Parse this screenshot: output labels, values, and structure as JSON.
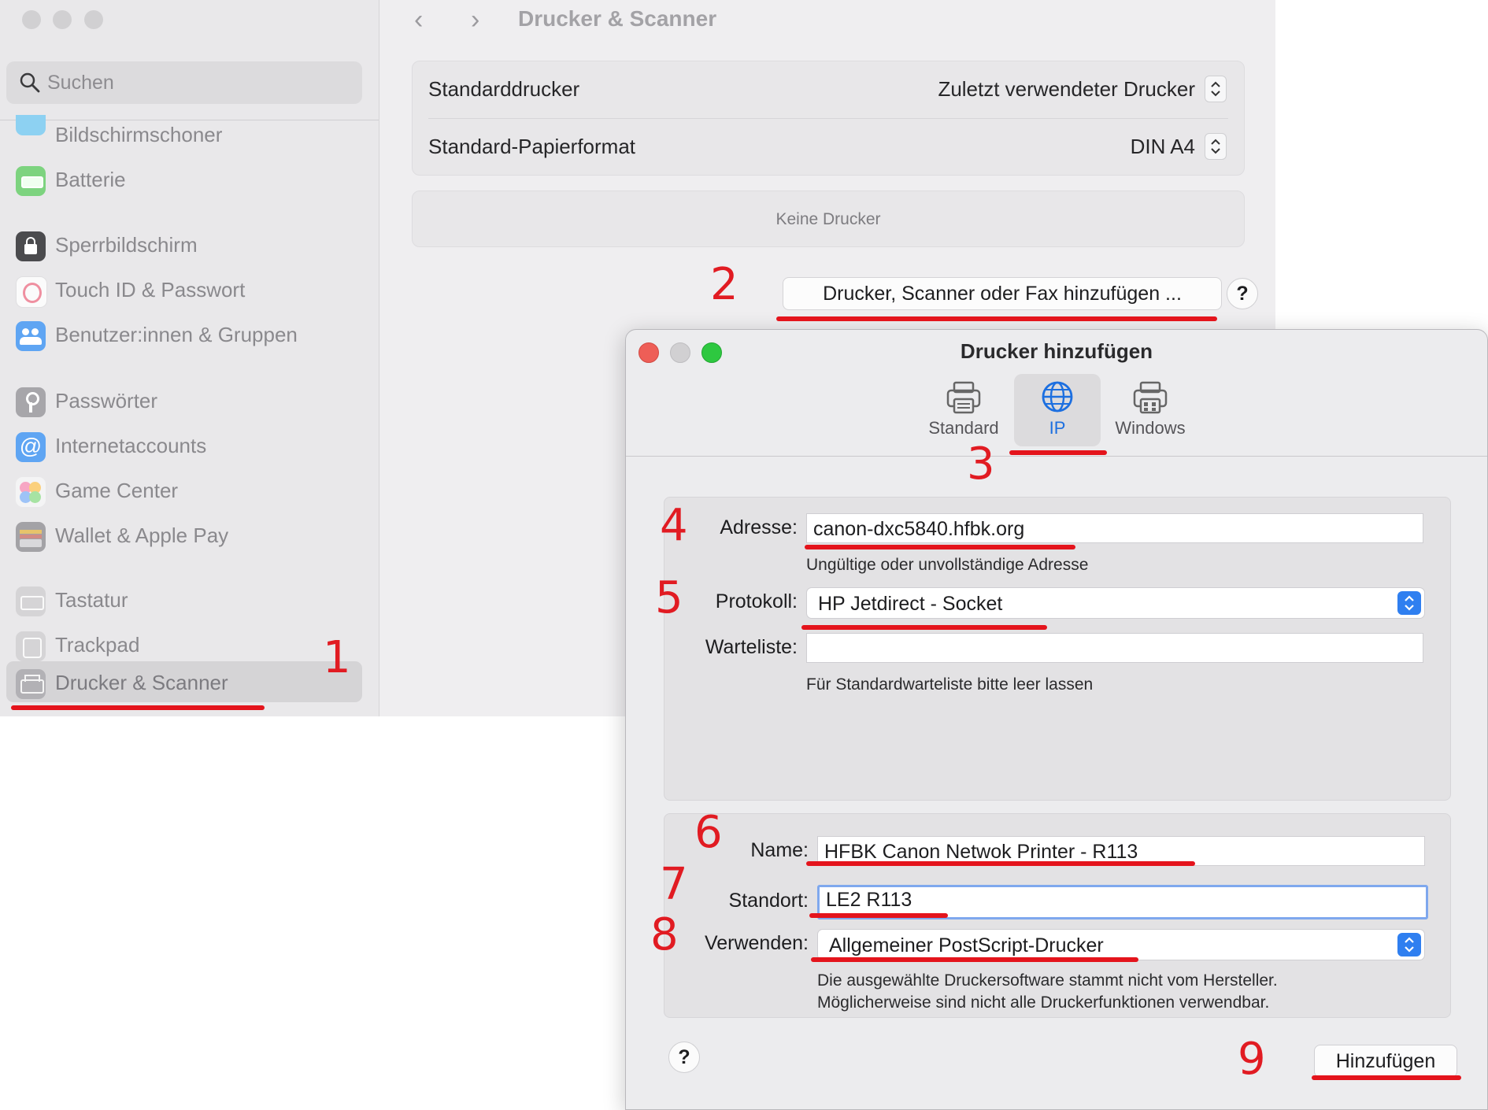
{
  "sidebar": {
    "search_placeholder": "Suchen",
    "items": [
      {
        "label": "Bildschirmschoner",
        "icon": "screensaver-icon"
      },
      {
        "label": "Batterie",
        "icon": "battery-icon"
      },
      {
        "label": "Sperrbildschirm",
        "icon": "lock-icon"
      },
      {
        "label": "Touch ID & Passwort",
        "icon": "fingerprint-icon"
      },
      {
        "label": "Benutzer:innen & Gruppen",
        "icon": "users-icon"
      },
      {
        "label": "Passwörter",
        "icon": "key-icon"
      },
      {
        "label": "Internetaccounts",
        "icon": "at-icon"
      },
      {
        "label": "Game Center",
        "icon": "game-center-icon"
      },
      {
        "label": "Wallet & Apple Pay",
        "icon": "wallet-icon"
      },
      {
        "label": "Tastatur",
        "icon": "keyboard-icon"
      },
      {
        "label": "Trackpad",
        "icon": "trackpad-icon"
      },
      {
        "label": "Drucker & Scanner",
        "icon": "printer-icon",
        "selected": true
      }
    ]
  },
  "main": {
    "title": "Drucker & Scanner",
    "default_printer_label": "Standarddrucker",
    "default_printer_value": "Zuletzt verwendeter Drucker",
    "paper_format_label": "Standard-Papierformat",
    "paper_format_value": "DIN A4",
    "no_printers": "Keine Drucker",
    "add_button": "Drucker, Scanner oder Fax hinzufügen ...",
    "help": "?"
  },
  "dialog": {
    "title": "Drucker hinzufügen",
    "tabs": [
      {
        "label": "Standard",
        "selected": false
      },
      {
        "label": "IP",
        "selected": true
      },
      {
        "label": "Windows",
        "selected": false
      }
    ],
    "address_label": "Adresse:",
    "address_value": "canon-dxc5840.hfbk.org",
    "address_hint": "Ungültige oder unvollständige Adresse",
    "protocol_label": "Protokoll:",
    "protocol_value": "HP Jetdirect - Socket",
    "queue_label": "Warteliste:",
    "queue_value": "",
    "queue_hint": "Für Standardwarteliste bitte leer lassen",
    "name_label": "Name:",
    "name_value": "HFBK Canon Netwok Printer - R113",
    "location_label": "Standort:",
    "location_value": "LE2 R113",
    "use_label": "Verwenden:",
    "use_value": "Allgemeiner PostScript-Drucker",
    "driver_note_1": "Die ausgewählte Druckersoftware stammt nicht vom Hersteller.",
    "driver_note_2": "Möglicherweise sind nicht alle Druckerfunktionen verwendbar.",
    "help": "?",
    "add_button": "Hinzufügen"
  },
  "annotations": [
    "1",
    "2",
    "3",
    "4",
    "5",
    "6",
    "7",
    "8",
    "9"
  ],
  "colors": {
    "annotation": "#e4141c",
    "accent": "#2f7ff0"
  }
}
